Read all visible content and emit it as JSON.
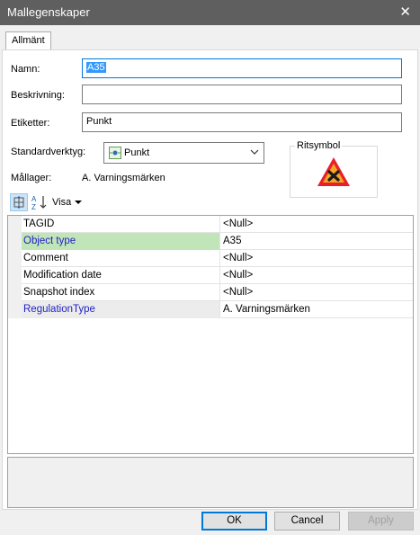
{
  "window": {
    "title": "Mallegenskaper",
    "close_glyph": "✕"
  },
  "tabs": [
    {
      "label": "Allmänt"
    }
  ],
  "form": {
    "name_label": "Namn:",
    "name_value": "A35",
    "description_label": "Beskrivning:",
    "description_value": "",
    "tags_label": "Etiketter:",
    "tags_value": "Punkt",
    "default_tool_label": "Standardverktyg:",
    "default_tool_value": "Punkt",
    "target_layer_label": "Mållager:",
    "target_layer_value": "A. Varningsmärken",
    "symbol_label": "Ritsymbol"
  },
  "toolbar": {
    "view_label": "Visa"
  },
  "properties": [
    {
      "name": "TAGID",
      "value": "<Null>",
      "style": "normal"
    },
    {
      "name": "Object type",
      "value": "A35",
      "style": "required-selected"
    },
    {
      "name": "Comment",
      "value": "<Null>",
      "style": "normal"
    },
    {
      "name": "Modification date",
      "value": "<Null>",
      "style": "normal"
    },
    {
      "name": "Snapshot index",
      "value": "<Null>",
      "style": "normal"
    },
    {
      "name": "RegulationType",
      "value": "A. Varningsmärken",
      "style": "required"
    }
  ],
  "buttons": {
    "ok": "OK",
    "cancel": "Cancel",
    "apply": "Apply"
  },
  "colors": {
    "titlebar": "#5f5f5f",
    "selection": "#3399ff",
    "required_text": "#1f1fc5",
    "highlight_row": "#bfe5b8",
    "warning_border": "#e8202a",
    "warning_fill": "#f5a623"
  },
  "icons": {
    "close": "close-icon",
    "tool": "point-tool-icon",
    "dropdown": "chevron-down-icon",
    "symbol": "warning-sign-icon",
    "categorized": "categorized-view-icon",
    "alphabetical": "sort-alphabetical-icon"
  }
}
